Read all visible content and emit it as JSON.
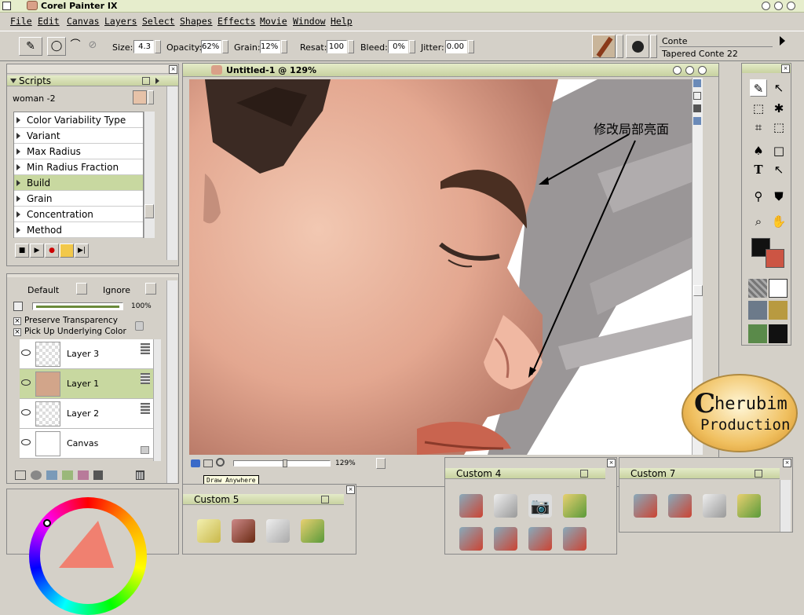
{
  "app": {
    "title": "Corel Painter IX"
  },
  "menu": [
    "File",
    "Edit",
    "Canvas",
    "Layers",
    "Select",
    "Shapes",
    "Effects",
    "Movie",
    "Window",
    "Help"
  ],
  "props": {
    "size_label": "Size:",
    "size": "4.3",
    "opacity_label": "Opacity:",
    "opacity": "62%",
    "grain_label": "Grain:",
    "grain": "12%",
    "resat_label": "Resat:",
    "resat": "100",
    "bleed_label": "Bleed:",
    "bleed": "0%",
    "jitter_label": "Jitter:",
    "jitter": "0.00",
    "brush_category": "Conte",
    "brush_variant": "Tapered Conte 22"
  },
  "scripts": {
    "title": "Scripts",
    "current": "woman -2",
    "items": [
      "Color Variability Type",
      "Variant",
      "Max Radius",
      "Min Radius Fraction",
      "Build",
      "Grain",
      "Concentration",
      "Method"
    ],
    "selected_index": 4
  },
  "layers": {
    "composite": "Default",
    "ignore": "Ignore",
    "opacity": "100%",
    "preserve": "Preserve Transparency",
    "pickup": "Pick Up Underlying Color",
    "items": [
      {
        "name": "Layer 3"
      },
      {
        "name": "Layer 1"
      },
      {
        "name": "Layer 2"
      },
      {
        "name": "Canvas"
      }
    ],
    "selected_index": 1
  },
  "document": {
    "title": "Untitled-1 @ 129%",
    "zoom": "129%",
    "tooltip": "Draw Anywhere",
    "annotation": "修改局部亮面"
  },
  "watermark": {
    "line1": "herubim",
    "line2": "Production",
    "c": "C"
  },
  "custom": {
    "p5": "Custom  5",
    "p4": "Custom  4",
    "p7": "Custom  7"
  },
  "colors": {
    "accent": "#c8d8a0",
    "main_color": "#111111",
    "second_color": "#cc5544"
  },
  "icons": [
    "brush-icon",
    "lasso-icon",
    "camera-icon",
    "eye-icon",
    "lock-icon",
    "trash-icon",
    "hand-icon",
    "magnifier-icon"
  ]
}
